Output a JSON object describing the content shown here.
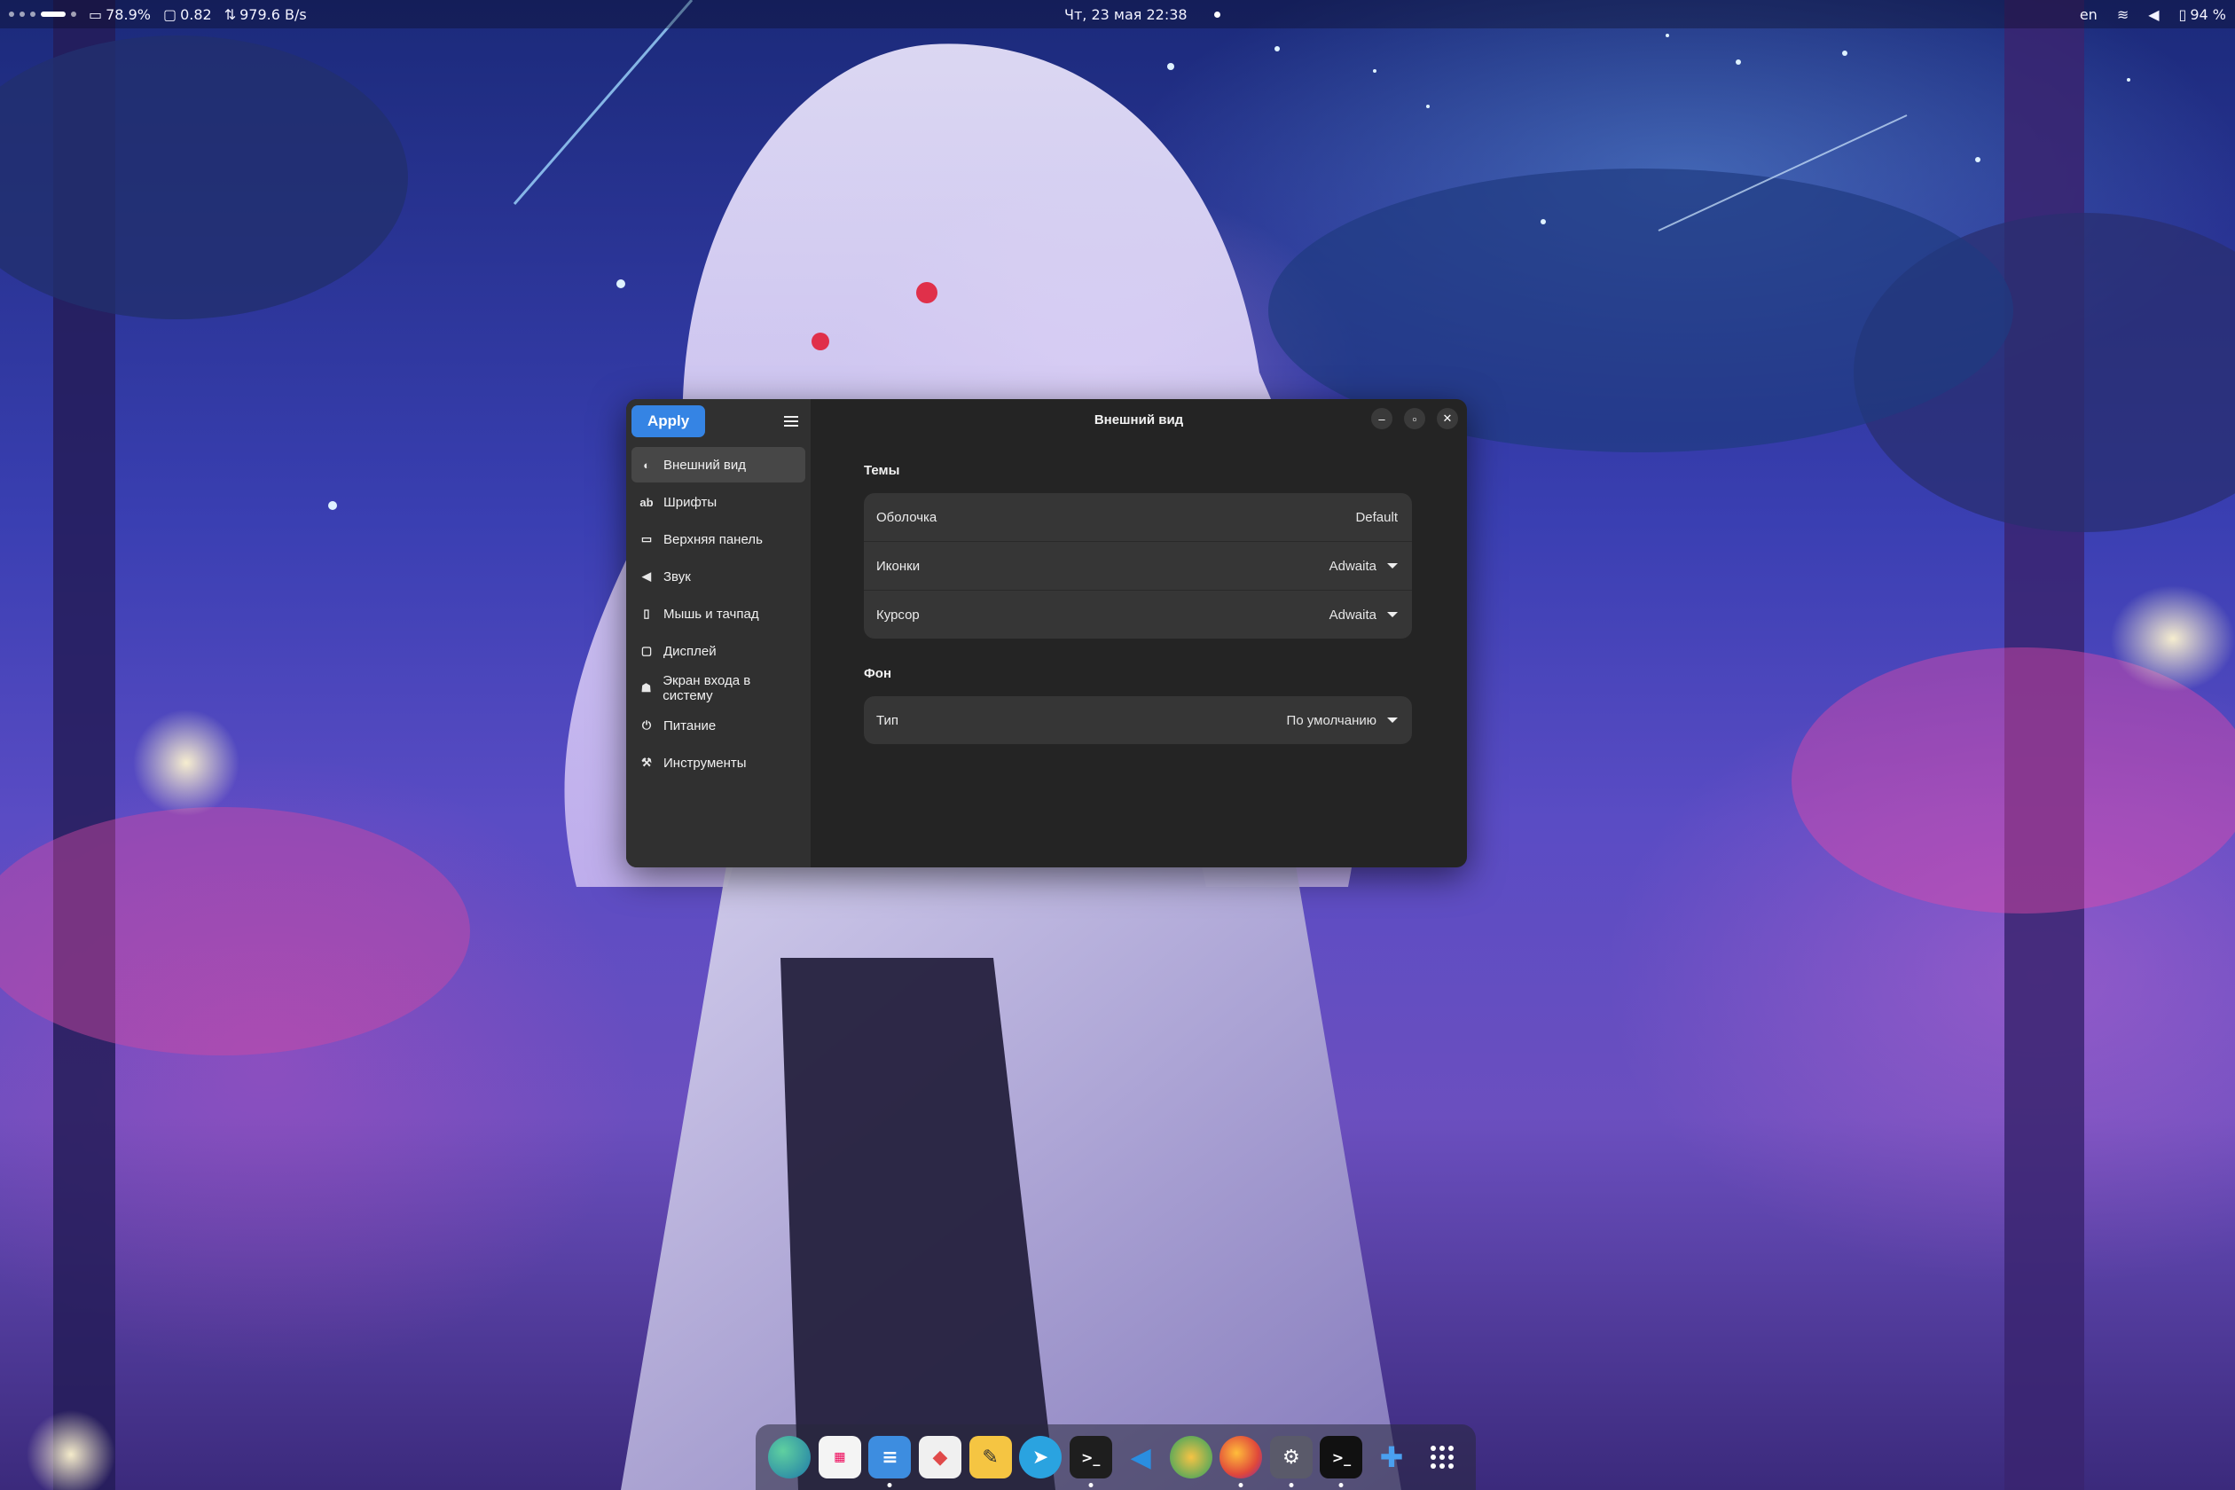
{
  "topbar": {
    "cpu": "78.9%",
    "load": "0.82",
    "net": "979.6 B/s",
    "datetime": "Чт, 23 мая  22:38",
    "lang": "en",
    "battery": "94 %"
  },
  "window": {
    "title": "Внешний вид",
    "apply_label": "Apply",
    "sidebar": {
      "items": [
        {
          "label": "Внешний вид",
          "icon": "appearance-icon"
        },
        {
          "label": "Шрифты",
          "icon": "fonts-icon"
        },
        {
          "label": "Верхняя панель",
          "icon": "top-panel-icon"
        },
        {
          "label": "Звук",
          "icon": "sound-icon"
        },
        {
          "label": "Мышь и тачпад",
          "icon": "mouse-icon"
        },
        {
          "label": "Дисплей",
          "icon": "display-icon"
        },
        {
          "label": "Экран входа в систему",
          "icon": "login-screen-icon"
        },
        {
          "label": "Питание",
          "icon": "power-icon"
        },
        {
          "label": "Инструменты",
          "icon": "tools-icon"
        }
      ]
    },
    "themes": {
      "title": "Темы",
      "shell_label": "Оболочка",
      "shell_value": "Default",
      "icons_label": "Иконки",
      "icons_value": "Adwaita",
      "cursor_label": "Курсор",
      "cursor_value": "Adwaita"
    },
    "background": {
      "title": "Фон",
      "type_label": "Тип",
      "type_value": "По умолчанию"
    }
  },
  "colors": {
    "accent": "#3584e4",
    "window_bg": "#242424",
    "sidebar_bg": "#303030",
    "card_bg": "#363636"
  },
  "dock": {
    "apps": [
      "globe-icon",
      "calendar-icon",
      "notes-icon",
      "software-store-icon",
      "text-editor-icon",
      "telegram-icon",
      "terminal-icon",
      "vscode-icon",
      "browser-icon",
      "firefox-icon",
      "toolbox-icon",
      "terminal-2-icon",
      "extensions-icon",
      "app-grid-icon"
    ]
  }
}
